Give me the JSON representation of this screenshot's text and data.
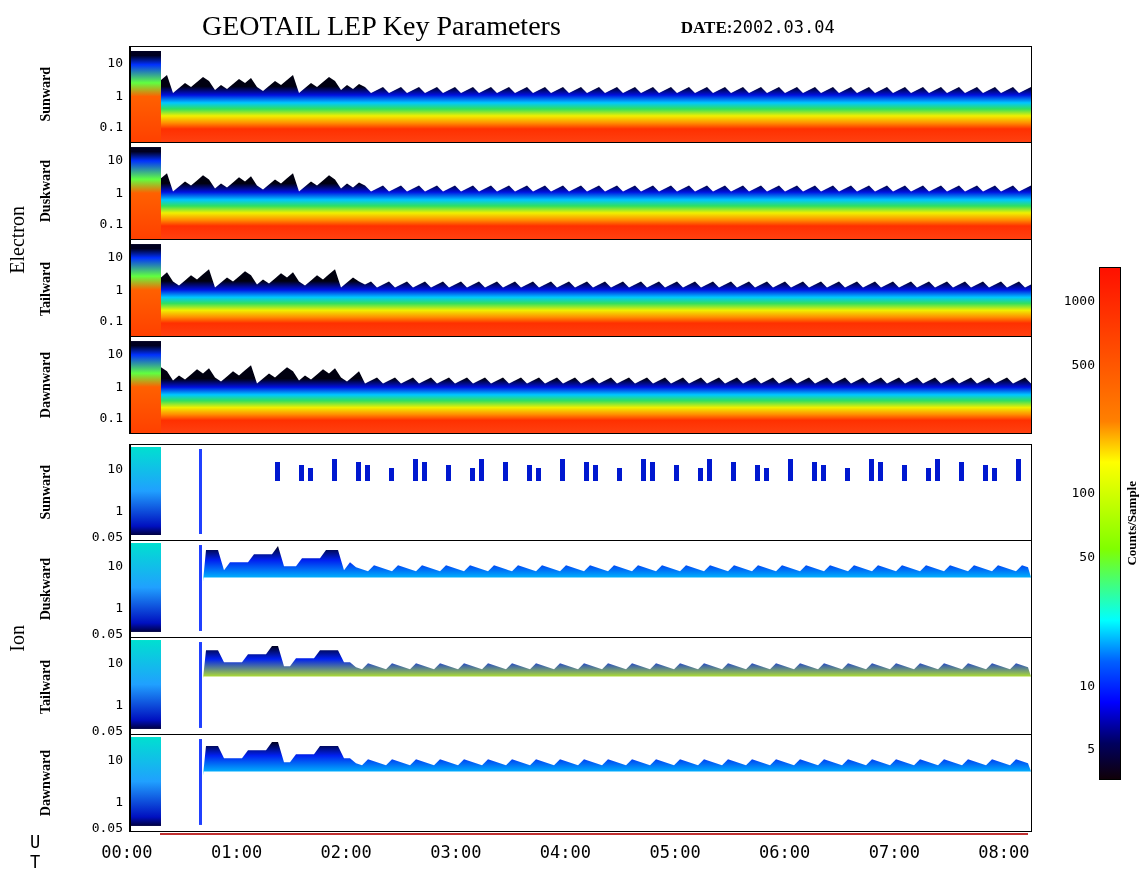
{
  "title": "GEOTAIL LEP Key Parameters",
  "date": {
    "label": "DATE:",
    "value": "2002.03.04"
  },
  "groups": [
    {
      "name": "Electron",
      "kind": "electron",
      "panels": [
        {
          "label": "Sunward",
          "ticks": [
            "10",
            "1",
            "0.1"
          ]
        },
        {
          "label": "Duskward",
          "ticks": [
            "10",
            "1",
            "0.1"
          ]
        },
        {
          "label": "Tailward",
          "ticks": [
            "10",
            "1",
            "0.1"
          ]
        },
        {
          "label": "Dawnward",
          "ticks": [
            "10",
            "1",
            "0.1"
          ]
        }
      ]
    },
    {
      "name": "Ion",
      "kind": "ion",
      "panels": [
        {
          "label": "Sunward",
          "ticks": [
            "10",
            "1",
            "0.05"
          ]
        },
        {
          "label": "Duskward",
          "ticks": [
            "10",
            "1",
            "0.05"
          ]
        },
        {
          "label": "Tailward",
          "ticks": [
            "10",
            "1",
            "0.05"
          ]
        },
        {
          "label": "Dawnward",
          "ticks": [
            "10",
            "1",
            "0.05"
          ]
        }
      ]
    }
  ],
  "time_axis": {
    "label": "U T",
    "ticks": [
      "00:00",
      "01:00",
      "02:00",
      "03:00",
      "04:00",
      "05:00",
      "06:00",
      "07:00",
      "08:00"
    ]
  },
  "colorbar": {
    "label": "Counts/Sample",
    "ticks": [
      "1000",
      "500",
      "100",
      "50",
      "10",
      "5"
    ]
  }
}
